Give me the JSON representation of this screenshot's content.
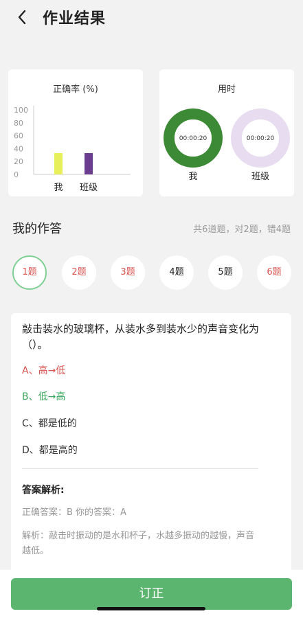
{
  "header": {
    "title": "作业结果"
  },
  "accuracy_card": {
    "title": "正确率 (%)",
    "chart_data": {
      "type": "bar",
      "categories": [
        "我",
        "班级"
      ],
      "values": [
        33,
        33
      ],
      "colors": [
        "#e7ef5a",
        "#6a3d8e"
      ],
      "yticks": [
        0,
        20,
        40,
        60,
        80,
        100
      ],
      "ylim": [
        0,
        100
      ]
    }
  },
  "time_card": {
    "title": "用时",
    "items": [
      {
        "label": "我",
        "time": "00:00:20",
        "color": "#3d8a36",
        "inner": "#ffffff"
      },
      {
        "label": "班级",
        "time": "00:00:20",
        "color": "#e8ddf0",
        "inner": "#ffffff"
      }
    ]
  },
  "answers": {
    "title": "我的作答",
    "summary": "共6道题，对2题，错4题",
    "questions": [
      {
        "label": "1题",
        "status": "wrong",
        "current": true
      },
      {
        "label": "2题",
        "status": "wrong",
        "current": false
      },
      {
        "label": "3题",
        "status": "wrong",
        "current": false
      },
      {
        "label": "4题",
        "status": "right",
        "current": false
      },
      {
        "label": "5题",
        "status": "right",
        "current": false
      },
      {
        "label": "6题",
        "status": "wrong",
        "current": false
      }
    ]
  },
  "question": {
    "stem": "敲击装水的玻璃杯，从装水多到装水少的声音变化为（）。",
    "options": [
      {
        "text": "A、高→低",
        "state": "wrong"
      },
      {
        "text": "B、低→高",
        "state": "correct"
      },
      {
        "text": "C、都是低的",
        "state": "normal"
      },
      {
        "text": "D、都是高的",
        "state": "normal"
      }
    ],
    "analysis_title": "答案解析:",
    "correct_answer": "正确答案：B   你的答案：A",
    "analysis": "解析：敲击时振动的是水和杯子，水越多振动的越慢，声音越低。"
  },
  "bottom": {
    "button": "订正"
  },
  "colors": {
    "accent": "#5bb56e",
    "wrong": "#d9534f",
    "correct": "#3aa75a"
  },
  "icons": {
    "back": "back-chevron-icon"
  }
}
